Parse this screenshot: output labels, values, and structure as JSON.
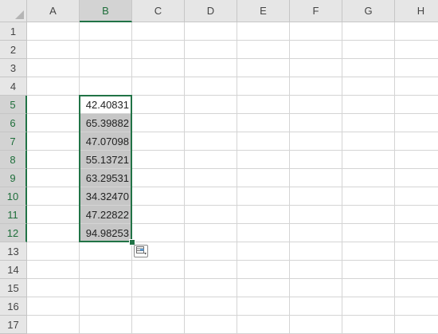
{
  "sheet": {
    "columns": [
      "A",
      "B",
      "C",
      "D",
      "E",
      "F",
      "G",
      "H"
    ],
    "rows": [
      "1",
      "2",
      "3",
      "4",
      "5",
      "6",
      "7",
      "8",
      "9",
      "10",
      "11",
      "12",
      "13",
      "14",
      "15",
      "16",
      "17"
    ],
    "selected_column": "B",
    "selected_rows": [
      "5",
      "6",
      "7",
      "8",
      "9",
      "10",
      "11",
      "12"
    ],
    "active_cell": "B5"
  },
  "column_b_values": [
    {
      "row": "5",
      "value": "42.40831"
    },
    {
      "row": "6",
      "value": "65.39882"
    },
    {
      "row": "7",
      "value": "47.07098"
    },
    {
      "row": "8",
      "value": "55.13721"
    },
    {
      "row": "9",
      "value": "63.29531"
    },
    {
      "row": "10",
      "value": "34.32470"
    },
    {
      "row": "11",
      "value": "47.22822"
    },
    {
      "row": "12",
      "value": "94.98253"
    }
  ],
  "icons": {
    "select_all": "select-all-triangle-icon",
    "quick_analysis": "quick-analysis-icon"
  },
  "colors": {
    "accent": "#217346",
    "header_bg": "#e6e6e6",
    "selected_header_bg": "#d3d3d3",
    "selection_fill": "#c6c6c6",
    "gridline": "#d4d4d4"
  }
}
